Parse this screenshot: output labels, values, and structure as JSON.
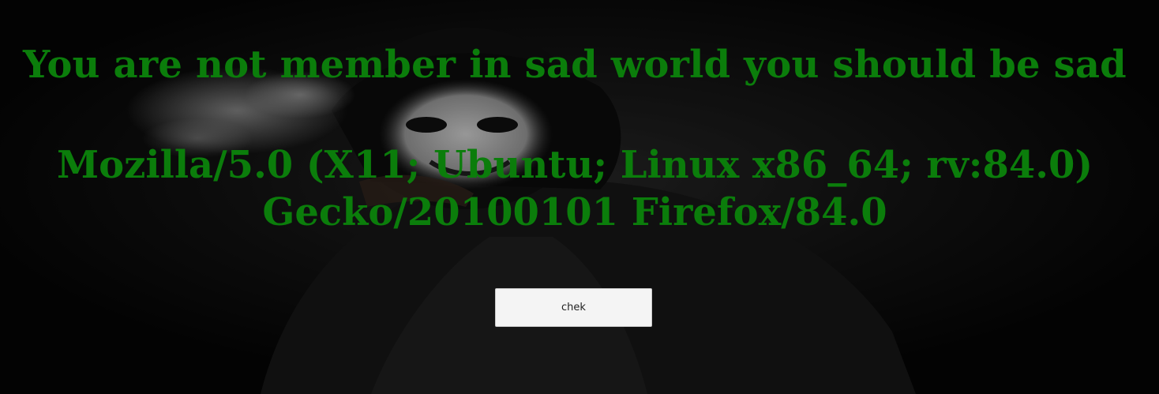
{
  "heading": "You are not member in sad world you should be sad",
  "user_agent": "Mozilla/5.0 (X11; Ubuntu; Linux x86_64; rv:84.0) Gecko/20100101 Firefox/84.0",
  "button": {
    "label": "chek"
  },
  "background_image": "joker-smoking-icon",
  "colors": {
    "text": "#0b7d0b",
    "background": "#050505",
    "button_bg": "#f4f4f4"
  }
}
